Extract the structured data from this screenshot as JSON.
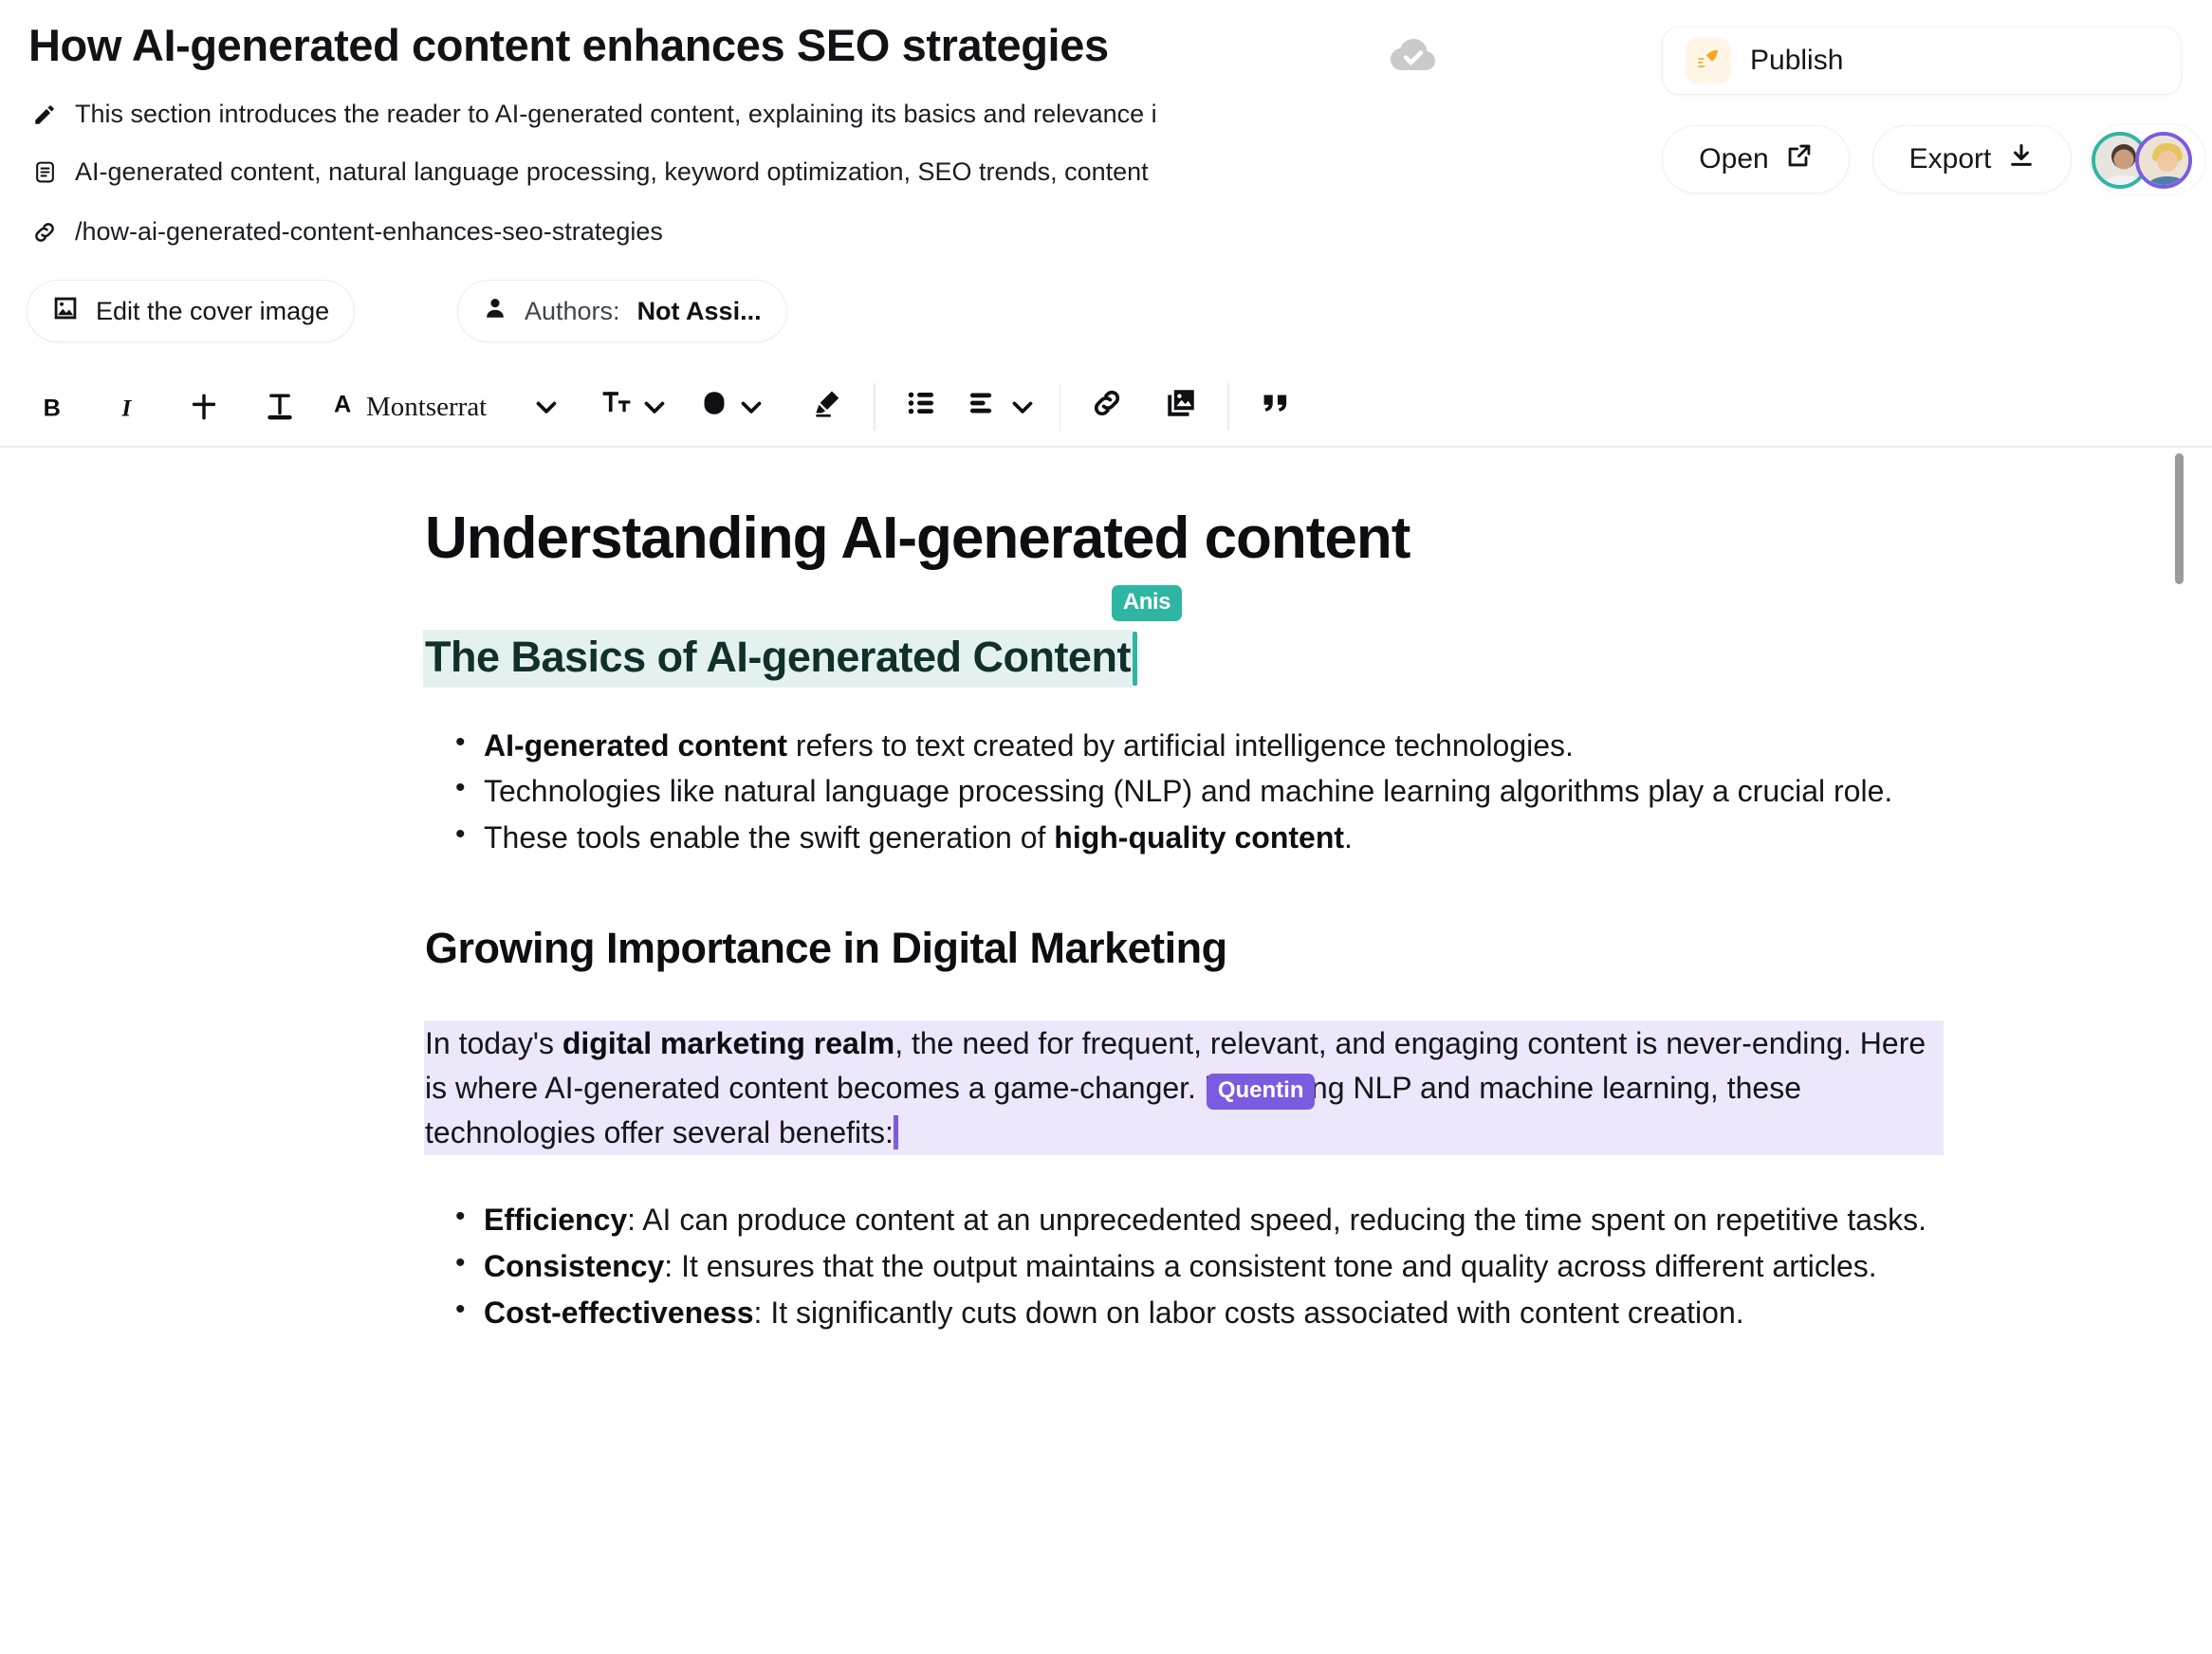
{
  "header": {
    "doc_title": "How AI-generated content enhances SEO strategies",
    "save_status_icon": "cloud-check-icon",
    "meta": {
      "description_icon": "pencil-icon",
      "description": "This section introduces the reader to AI-generated content, explaining its basics and relevance i",
      "keywords_icon": "document-icon",
      "keywords": "AI-generated content, natural language processing, keyword optimization, SEO trends, content",
      "slug_icon": "link-icon",
      "slug": "/how-ai-generated-content-enhances-seo-strategies"
    },
    "cover_button": {
      "icon": "image-icon",
      "label": "Edit the cover image"
    },
    "authors_button": {
      "icon": "user-icon",
      "label": "Authors:",
      "value": "Not Assi..."
    },
    "publish_button": {
      "icon": "rocket-icon",
      "label": "Publish"
    },
    "open_button": {
      "label": "Open",
      "icon": "external-link-icon"
    },
    "export_button": {
      "label": "Export",
      "icon": "download-icon"
    },
    "collaborators": [
      {
        "name": "Anis",
        "ring_color": "#2fb6a2"
      },
      {
        "name": "Quentin",
        "ring_color": "#7b5ce0"
      }
    ]
  },
  "toolbar": {
    "bold": {
      "icon": "bold-icon",
      "label": "B"
    },
    "italic": {
      "icon": "italic-icon",
      "label": "I"
    },
    "strikethrough": {
      "icon": "strikethrough-icon"
    },
    "underline": {
      "icon": "underline-icon"
    },
    "font_icon": "font-letter-icon",
    "font_family": "Montserrat",
    "font_family_chevron": "chevron-down-icon",
    "font_size_icon": "font-size-icon",
    "font_size_chevron": "chevron-down-icon",
    "text_color_icon": "color-swatch-icon",
    "text_color_chevron": "chevron-down-icon",
    "highlighter_icon": "highlighter-icon",
    "bullet_list_icon": "bullet-list-icon",
    "align_icon": "align-left-icon",
    "align_chevron": "chevron-down-icon",
    "link_icon": "link-icon",
    "image_icon": "image-stack-icon",
    "quote_icon": "quote-icon"
  },
  "document": {
    "h1": "Understanding AI-generated content",
    "section1": {
      "heading": "The Basics of AI-generated Content",
      "selected": true,
      "cursor_label": "Anis",
      "cursor_color": "#2fb6a2",
      "highlight_color": "#e4f2ef",
      "bullets": [
        {
          "bold": "AI-generated content",
          "rest": " refers to text created by artificial intelligence technologies."
        },
        {
          "bold": "",
          "rest": "Technologies like natural language processing (NLP) and machine learning algorithms play a crucial role."
        },
        {
          "pre": "These tools enable the swift generation of ",
          "bold": "high-quality content",
          "rest": "."
        }
      ]
    },
    "section2": {
      "heading": "Growing Importance in Digital Marketing",
      "paragraph": {
        "p1": "In today's ",
        "b1": "digital marketing realm",
        "p2": ", the need for frequent, relevant, and engaging content is never-ending. Here is where AI-generated content becomes a game-changer. ",
        "cursor_label": "Quentin",
        "p3": "leveraging NLP and machine learning, these technologies offer several benefits:",
        "cursor_color": "#7b5ce0",
        "highlight_color": "#ece7fb"
      },
      "bullets": [
        {
          "bold": "Efficiency",
          "rest": ": AI can produce content at an unprecedented speed, reducing the time spent on repetitive tasks."
        },
        {
          "bold": "Consistency",
          "rest": ": It ensures that the output maintains a consistent tone and quality across different articles."
        },
        {
          "bold": "Cost-effectiveness",
          "rest": ": It significantly cuts down on labor costs associated with content creation."
        }
      ]
    }
  },
  "scrollbar": {
    "name": "vertical-scrollbar"
  }
}
